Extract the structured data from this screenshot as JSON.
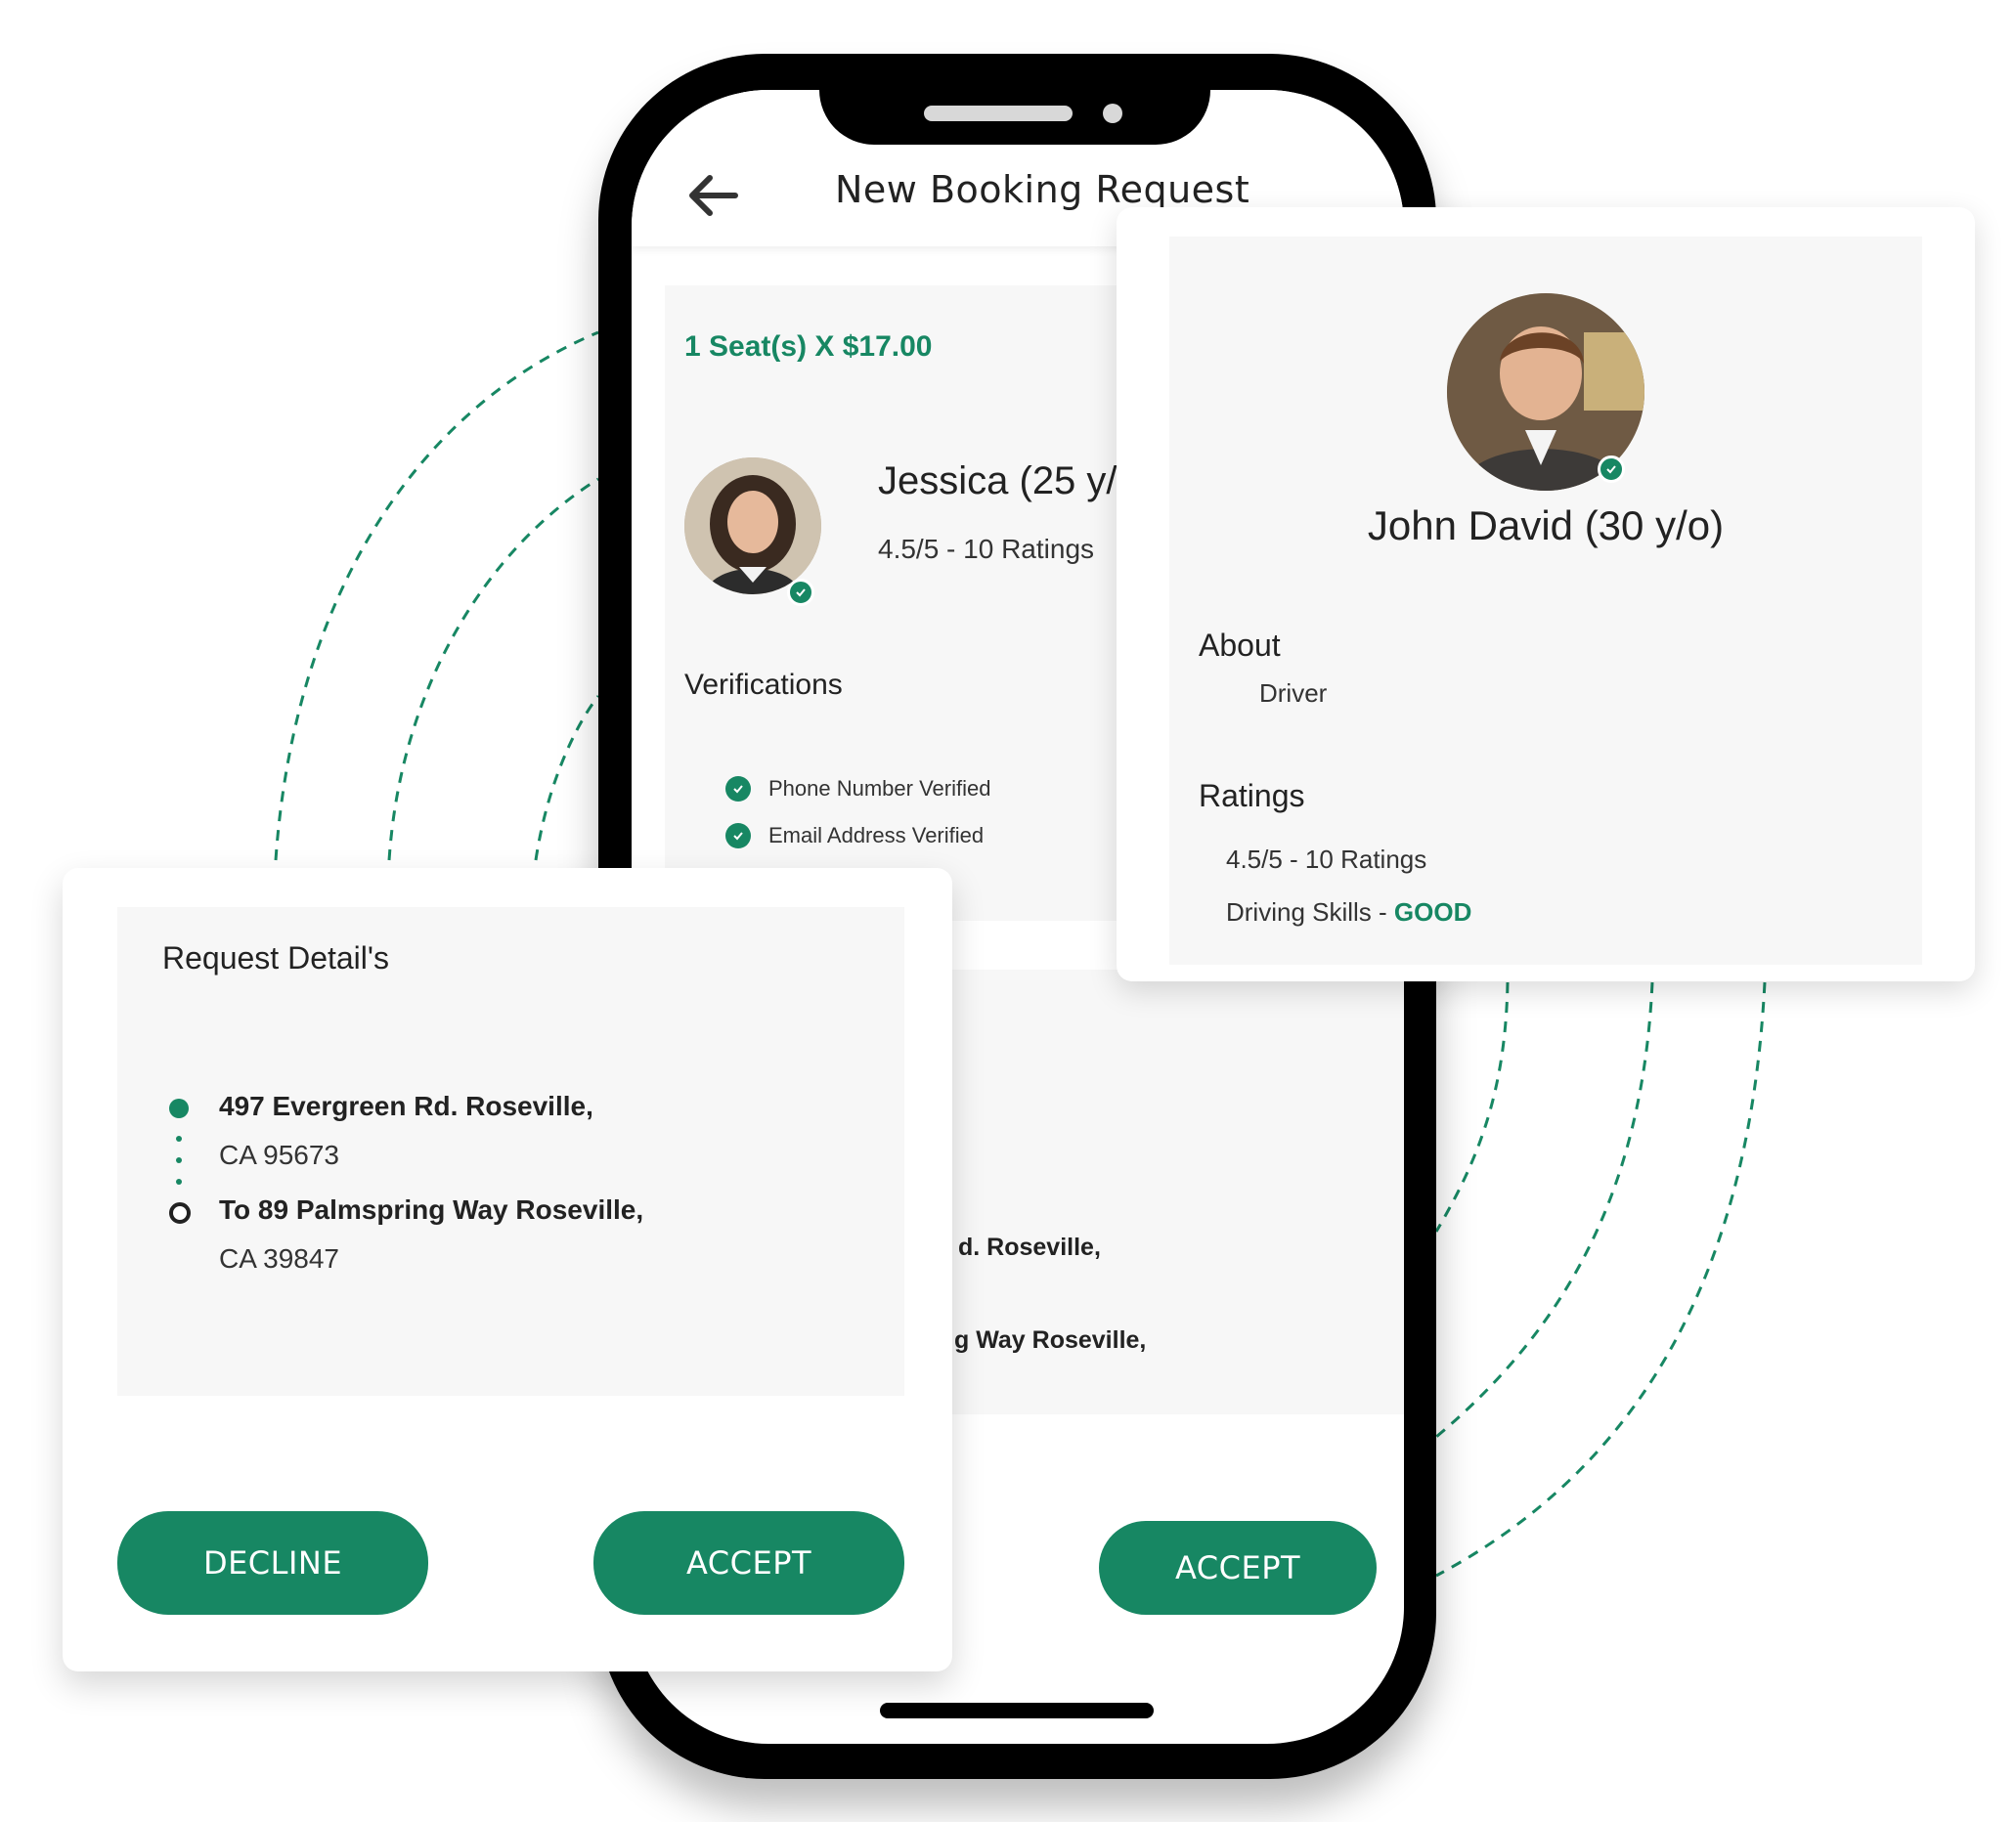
{
  "theme": {
    "accent": "#178763",
    "panel_bg": "#f7f7f7",
    "frame": "#000000"
  },
  "screen": {
    "title": "New Booking Request",
    "back_icon": "arrow-left-icon"
  },
  "booking": {
    "seat_price": "1 Seat(s) X $17.00",
    "passenger_name": "Jessica (25 y/",
    "passenger_rating": "4.5/5  - 10 Ratings",
    "verifications_title": "Verifications",
    "verifications": [
      {
        "label": "Phone Number Verified",
        "icon": "check-circle-icon"
      },
      {
        "label": "Email Address  Verified",
        "icon": "check-circle-icon"
      }
    ],
    "partial_address_1": "d. Roseville,",
    "partial_address_2": "g Way Roseville,",
    "accept_label": "ACCEPT"
  },
  "driver": {
    "name": "John David (30 y/o)",
    "about_label": "About",
    "about_value": "Driver",
    "ratings_label": "Ratings",
    "ratings_value": "4.5/5  - 10 Ratings",
    "skills_label": "Driving Skills - ",
    "skills_value": "GOOD"
  },
  "request": {
    "title": "Request Detail's",
    "from_line1": "497 Evergreen Rd. Roseville,",
    "from_line2": "CA 95673",
    "to_line1": "To 89 Palmspring Way Roseville,",
    "to_line2": "CA 39847",
    "decline_label": "DECLINE",
    "accept_label": "ACCEPT"
  }
}
